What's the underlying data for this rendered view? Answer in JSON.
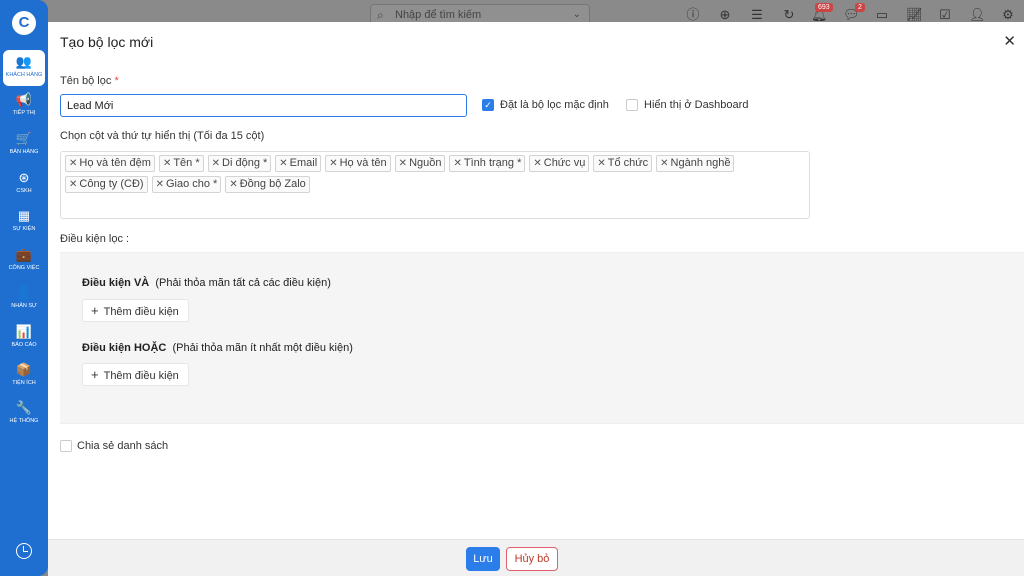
{
  "sidebar": {
    "logo": "C",
    "items": [
      {
        "label": "KHÁCH HÀNG",
        "icon": "users-icon",
        "glyph": "👥",
        "active": true
      },
      {
        "label": "TIẾP THỊ",
        "icon": "megaphone-icon",
        "glyph": "📢",
        "active": false
      },
      {
        "label": "BÁN HÀNG",
        "icon": "cart-icon",
        "glyph": "🛒",
        "active": false
      },
      {
        "label": "CSKH",
        "icon": "lifebuoy-icon",
        "glyph": "⊛",
        "active": false
      },
      {
        "label": "SỰ KIỆN",
        "icon": "calendar-icon",
        "glyph": "▦",
        "active": false
      },
      {
        "label": "CÔNG VIỆC",
        "icon": "briefcase-icon",
        "glyph": "💼",
        "active": false
      },
      {
        "label": "NHÂN SỰ",
        "icon": "person-icon",
        "glyph": "👤",
        "active": false
      },
      {
        "label": "BÁO CÁO",
        "icon": "report-icon",
        "glyph": "📊",
        "active": false
      },
      {
        "label": "TIỆN ÍCH",
        "icon": "box-icon",
        "glyph": "📦",
        "active": false
      },
      {
        "label": "HỆ THỐNG",
        "icon": "wrench-icon",
        "glyph": "🔧",
        "active": false
      }
    ]
  },
  "topbar": {
    "search_placeholder": "Nhập để tìm kiếm",
    "notification_count": "693",
    "chat_count": "2"
  },
  "modal": {
    "title": "Tạo bộ lọc mới",
    "name_label": "Tên bộ lọc",
    "name_required": "*",
    "name_value": "Lead Mới",
    "default_checkbox_label": "Đặt là bộ lọc mặc định",
    "default_checked": true,
    "dashboard_checkbox_label": "Hiển thị ở Dashboard",
    "dashboard_checked": false,
    "columns_label": "Chọn cột và thứ tự hiển thị (Tối đa 15 cột)",
    "columns": [
      "Họ và tên đệm",
      "Tên *",
      "Di động *",
      "Email",
      "Họ và tên",
      "Nguồn",
      "Tình trạng *",
      "Chức vụ",
      "Tổ chức",
      "Ngành nghề",
      "Công ty (CĐ)",
      "Giao cho *",
      "Đồng bộ Zalo"
    ],
    "conditions_label": "Điều kiện lọc :",
    "and_title": "Điều kiện VÀ",
    "and_desc": "(Phải thỏa mãn tất cả các điều kiện)",
    "or_title": "Điều kiện HOẶC",
    "or_desc": "(Phải thỏa mãn ít nhất một điều kiện)",
    "add_condition_label": "Thêm điều kiện",
    "share_label": "Chia sẻ danh sách",
    "save_label": "Lưu",
    "cancel_label": "Hủy bỏ"
  }
}
